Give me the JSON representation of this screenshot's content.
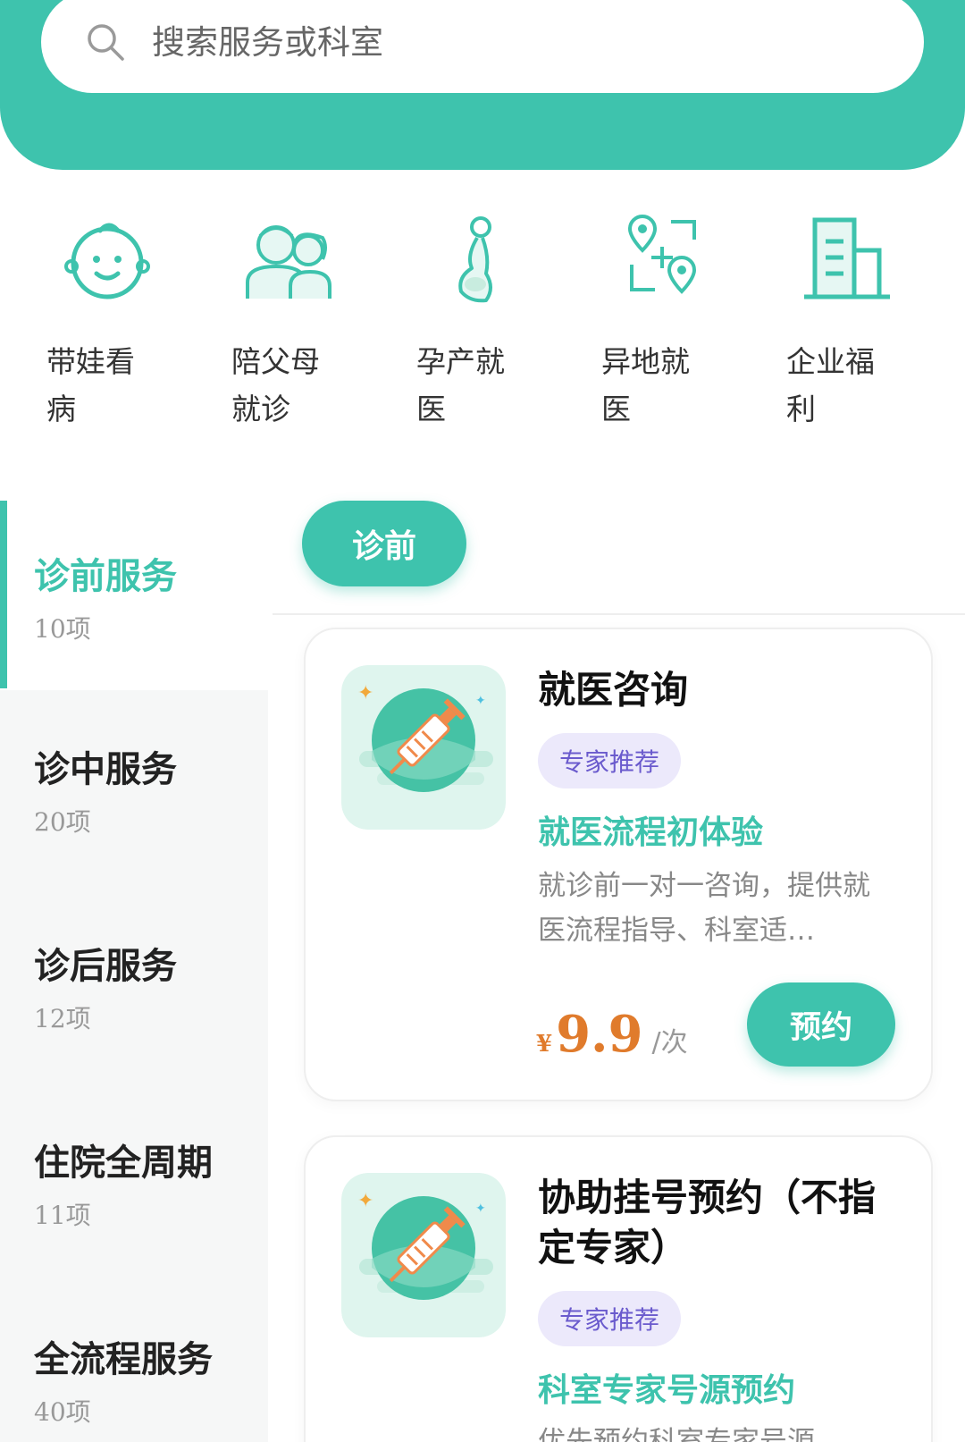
{
  "search": {
    "placeholder": "搜索服务或科室"
  },
  "quick_entries": [
    {
      "label": "带娃看病",
      "icon": "baby-face-icon"
    },
    {
      "label": "陪父母就诊",
      "icon": "elderly-couple-icon"
    },
    {
      "label": "孕产就医",
      "icon": "pregnant-woman-icon"
    },
    {
      "label": "异地就医",
      "icon": "location-transfer-icon"
    },
    {
      "label": "企业福利",
      "icon": "office-building-icon"
    }
  ],
  "categories": [
    {
      "title": "诊前服务",
      "count": "10项",
      "active": true
    },
    {
      "title": "诊中服务",
      "count": "20项",
      "active": false
    },
    {
      "title": "诊后服务",
      "count": "12项",
      "active": false
    },
    {
      "title": "住院全周期",
      "count": "11项",
      "active": false
    },
    {
      "title": "全流程服务",
      "count": "40项",
      "active": false
    }
  ],
  "tab": {
    "label": "诊前"
  },
  "cards": [
    {
      "title": "就医咨询",
      "badge": "专家推荐",
      "subtitle": "就医流程初体验",
      "description": "就诊前一对一咨询，提供就医流程指导、科室适…",
      "price_symbol": "¥",
      "price": "9.9",
      "price_unit": "/次",
      "button_label": "预约",
      "icon": "syringe-icon"
    },
    {
      "title": "协助挂号预约（不指定专家）",
      "badge": "专家推荐",
      "subtitle": "科室专家号源预约",
      "description": "优先预约科室专家号源",
      "icon": "syringe-icon"
    }
  ],
  "colors": {
    "accent": "#3ec3ad",
    "price": "#e07b2c",
    "badge_bg": "#ece9fb",
    "badge_text": "#6a5acd"
  }
}
